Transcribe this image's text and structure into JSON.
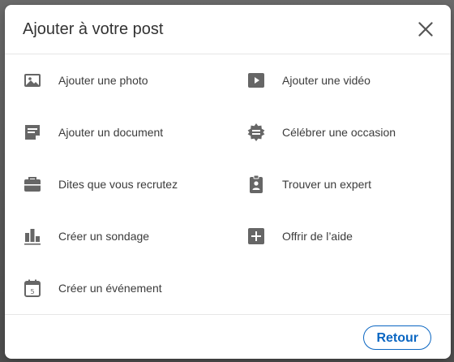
{
  "dialog": {
    "title": "Ajouter à votre post",
    "close_icon": "close-icon"
  },
  "options": [
    {
      "label": "Ajouter une photo",
      "icon": "photo-icon"
    },
    {
      "label": "Ajouter une vidéo",
      "icon": "video-icon"
    },
    {
      "label": "Ajouter un document",
      "icon": "document-icon"
    },
    {
      "label": "Célébrer une occasion",
      "icon": "celebrate-icon"
    },
    {
      "label": "Dites que vous recrutez",
      "icon": "briefcase-icon"
    },
    {
      "label": "Trouver un expert",
      "icon": "expert-badge-icon"
    },
    {
      "label": "Créer un sondage",
      "icon": "poll-icon"
    },
    {
      "label": "Offrir de l’aide",
      "icon": "plus-box-icon"
    },
    {
      "label": "Créer un événement",
      "icon": "calendar-icon"
    }
  ],
  "footer": {
    "back_label": "Retour"
  },
  "colors": {
    "accent": "#0a66c2",
    "icon": "#666666",
    "text": "#3b3b3b"
  }
}
